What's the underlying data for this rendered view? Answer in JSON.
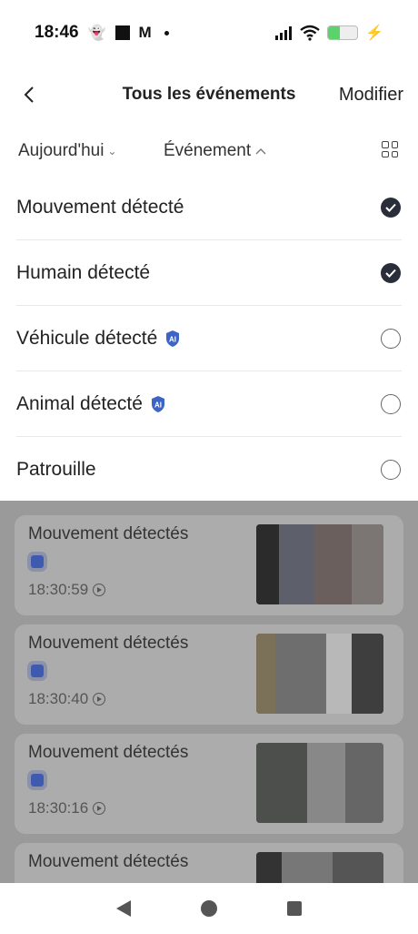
{
  "status": {
    "time": "18:46"
  },
  "header": {
    "title": "Tous les événements",
    "modify_label": "Modifier"
  },
  "filters": {
    "date_label": "Aujourd'hui",
    "event_label": "Événement"
  },
  "options": [
    {
      "label": "Mouvement détecté",
      "checked": true,
      "ai": false
    },
    {
      "label": "Humain détecté",
      "checked": true,
      "ai": false
    },
    {
      "label": "Véhicule détecté",
      "checked": false,
      "ai": true
    },
    {
      "label": "Animal détecté",
      "checked": false,
      "ai": true
    },
    {
      "label": "Patrouille",
      "checked": false,
      "ai": false
    }
  ],
  "events": [
    {
      "title": "Mouvement détectés",
      "time": "18:30:59"
    },
    {
      "title": "Mouvement détectés",
      "time": "18:30:40"
    },
    {
      "title": "Mouvement détectés",
      "time": "18:30:16"
    },
    {
      "title": "Mouvement détectés",
      "time": ""
    }
  ],
  "colors": {
    "accent": "#2a2d3a",
    "ai_badge": "#3d63c7"
  }
}
